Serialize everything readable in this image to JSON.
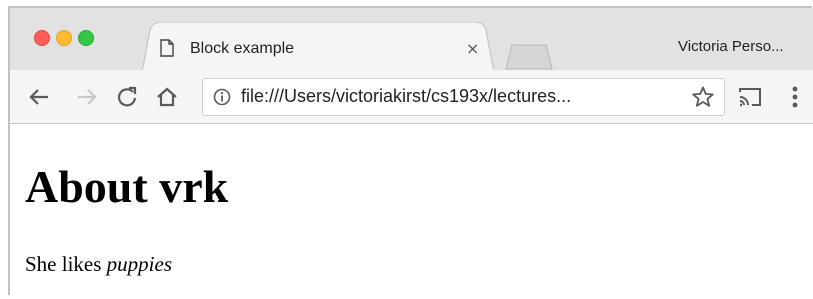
{
  "window": {
    "profile_name": "Victoria Perso..."
  },
  "tab": {
    "title": "Block example",
    "close_glyph": "×",
    "icon": "document-icon"
  },
  "toolbar": {
    "url": "file:///Users/victoriakirst/cs193x/lectures...",
    "icons": [
      "back-arrow-icon",
      "forward-arrow-icon",
      "reload-icon",
      "home-icon",
      "info-icon",
      "star-icon",
      "cast-icon",
      "kebab-menu-icon"
    ]
  },
  "page": {
    "heading": "About vrk",
    "paragraph_prefix": "She likes ",
    "paragraph_emphasis": "puppies"
  },
  "colors": {
    "close": "#fc5b57",
    "minimize": "#fdbc2f",
    "maximize": "#33c748",
    "tabstrip_bg": "#e2e2e2",
    "toolbar_bg": "#f5f5f5"
  }
}
